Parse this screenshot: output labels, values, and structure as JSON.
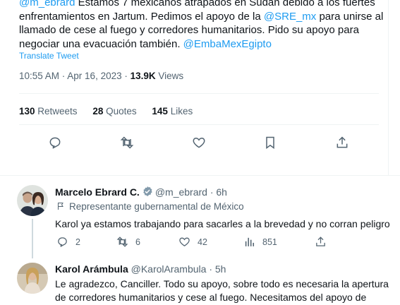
{
  "tweet": {
    "text_mention": "@m_ebrard",
    "text_part1": " Estamos 7 mexicanos atrapados en Sudán debido a los fuertes enfrentamientos en Jartum. Pedimos el apoyo de la ",
    "text_mention2": "@SRE_mx",
    "text_part2": " para unirse al llamado de cese al fuego y corredores humanitarios. Pido su apoyo para negociar una evacuación también. ",
    "text_mention3": "@EmbaMexEgipto",
    "translate": "Translate Tweet",
    "time": "10:55 AM · Apr 16, 2023 · ",
    "views_count": "13.9K",
    "views_label": " Views",
    "retweets_count": "130",
    "retweets_label": " Retweets",
    "quotes_count": "28",
    "quotes_label": " Quotes",
    "likes_count": "145",
    "likes_label": " Likes"
  },
  "reply1": {
    "name": "Marcelo Ebrard C.",
    "handle": "@m_ebrard · 6h",
    "label": "Representante gubernamental de México",
    "text": "Karol ya estamos trabajando para sacarles a la brevedad y no corran peligro",
    "replies": "2",
    "retweets": "6",
    "likes": "42",
    "views": "851"
  },
  "reply2": {
    "name": "Karol Arámbula",
    "handle": "@KarolArambula · 5h",
    "text_line1": "Le agradezco, Canciller. Todo su apoyo, sobre todo es necesaria la apertura",
    "text_line2": "de corredores humanitarios y cese al fuego. Necesitamos del apoyo de"
  },
  "colors": {
    "accent": "#1d9bf0",
    "text": "#0f1419",
    "muted": "#536471",
    "verified": "#829aab"
  }
}
